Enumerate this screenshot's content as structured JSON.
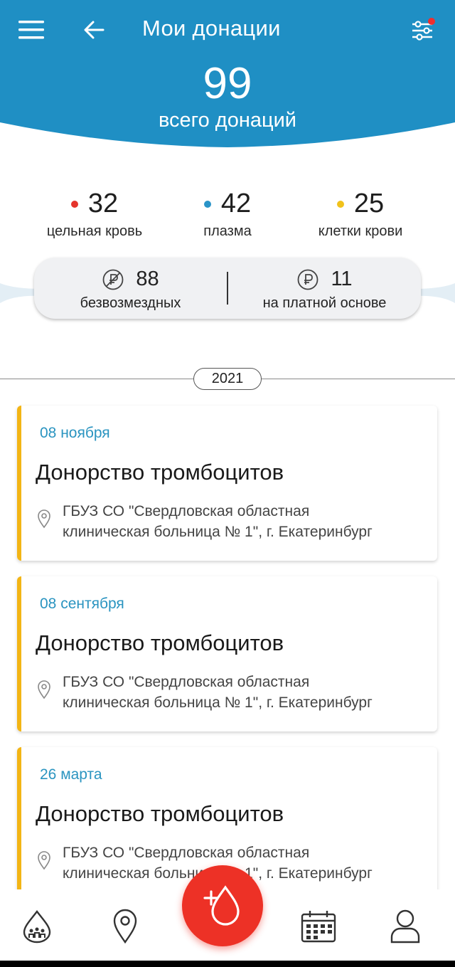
{
  "header": {
    "title": "Мои донации",
    "total_count": "99",
    "total_label": "всего донаций",
    "bg_color": "#1f8fc4",
    "filter_badge_color": "#ee2f2f"
  },
  "stats": [
    {
      "value": "32",
      "label": "цельная кровь",
      "dot_color": "#e5342c"
    },
    {
      "value": "42",
      "label": "плазма",
      "dot_color": "#2a94c8"
    },
    {
      "value": "25",
      "label": "клетки крови",
      "dot_color": "#f1c21b"
    }
  ],
  "payment": {
    "free_value": "88",
    "free_label": "безвозмездных",
    "free_icon": "no-ruble-icon",
    "paid_value": "11",
    "paid_label": "на платной основе",
    "paid_icon": "ruble-icon"
  },
  "year": "2021",
  "donations": [
    {
      "date": "08 ноября",
      "title": "Донорство тромбоцитов",
      "address_line1": "ГБУЗ СО \"Свердловская областная",
      "address_line2": "клиническая больница № 1\", г. Екатеринбург"
    },
    {
      "date": "08 сентября",
      "title": "Донорство тромбоцитов",
      "address_line1": "ГБУЗ СО \"Свердловская областная",
      "address_line2": "клиническая больница № 1\", г. Екатеринбург"
    },
    {
      "date": "26 марта",
      "title": "Донорство тромбоцитов",
      "address_line1": "ГБУЗ СО \"Свердловская областная",
      "address_line2": "клиническая больница № 1\", г. Екатеринбург"
    }
  ],
  "accent_color": "#f3b515",
  "bottom_nav": {
    "items": [
      "donors-community-icon",
      "map-pin-icon",
      "add-donation-icon",
      "calendar-icon",
      "profile-icon"
    ],
    "fab_color": "#ed3126"
  }
}
